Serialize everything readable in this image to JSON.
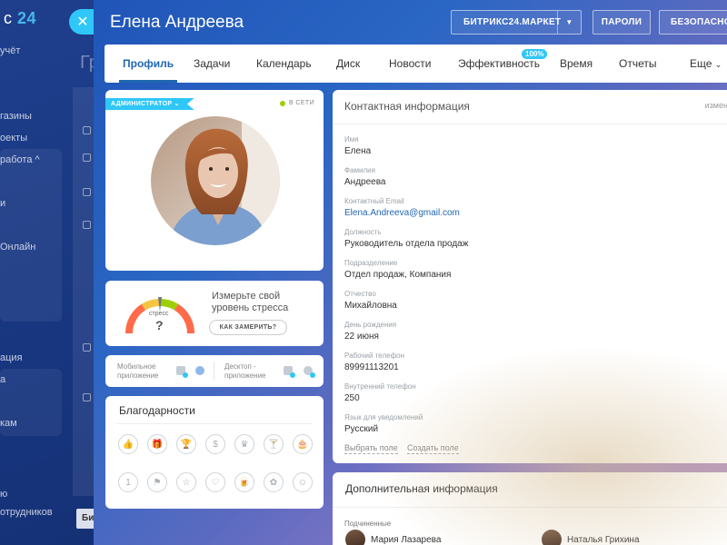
{
  "background": {
    "logo_prefix": "с",
    "logo_number": "24",
    "main_title": "Гр",
    "bottom_button": "Би",
    "sidebar_items": [
      "учёт",
      "газины",
      "оекты",
      "работа ^",
      "и",
      "Онлайн",
      "ация",
      "а",
      "кам",
      "ю",
      "отрудников"
    ]
  },
  "close_button": "✕",
  "profile": {
    "name": "Елена Андреева",
    "market_button": "БИТРИКС24.МАРКЕТ",
    "passwords_button": "ПАРОЛИ",
    "security_button": "БЕЗОПАСНОСТЬ"
  },
  "tabs": [
    {
      "label": "Профиль",
      "active": true
    },
    {
      "label": "Задачи"
    },
    {
      "label": "Календарь"
    },
    {
      "label": "Диск"
    },
    {
      "label": "Новости"
    },
    {
      "label": "Эффективность",
      "badge": "100%"
    },
    {
      "label": "Время"
    },
    {
      "label": "Отчеты"
    },
    {
      "label": "Еще"
    }
  ],
  "avatar_card": {
    "role": "АДМИНИСТРАТОР",
    "status": "В СЕТИ",
    "status_color": "#9dcf00"
  },
  "stress": {
    "gauge_label": "стресс",
    "gauge_value": "?",
    "text": "Измерьте свой уровень стресса",
    "text_line1": "Измерьте свой",
    "text_line2": "уровень стресса",
    "button": "КАК ЗАМЕРИТЬ?"
  },
  "apps": {
    "mobile_line1": "Мобильное",
    "mobile_line2": "приложение",
    "desktop_line1": "Десктоп -",
    "desktop_line2": "приложение"
  },
  "thanks": {
    "title": "Благодарности",
    "badges": [
      "thumbs-up",
      "gift",
      "cup",
      "money",
      "crown",
      "drink",
      "cake",
      "number-one",
      "flag",
      "star",
      "heart",
      "beer",
      "flower",
      "smile"
    ]
  },
  "contact": {
    "title": "Контактная информация",
    "edit": "измени",
    "fields": [
      {
        "label": "Имя",
        "value": "Елена"
      },
      {
        "label": "Фамилия",
        "value": "Андреева"
      },
      {
        "label": "Контактный Email",
        "value": "Elena.Andreeva@gmail.com"
      },
      {
        "label": "Должность",
        "value": "Руководитель отдела продаж"
      },
      {
        "label": "Подразделение",
        "value": "Отдел продаж, Компания"
      },
      {
        "label": "Отчество",
        "value": "Михайловна"
      },
      {
        "label": "День рождения",
        "value": "22 июня"
      },
      {
        "label": "Рабочий телефон",
        "value": "89991113201"
      },
      {
        "label": "Внутренний телефон",
        "value": "250"
      },
      {
        "label": "Язык для уведомлений",
        "value": "Русский"
      }
    ],
    "choose_field": "Выбрать поле",
    "create_field": "Создать поле"
  },
  "extra": {
    "title": "Дополнительная информация",
    "subordinates_label": "Подчиненные",
    "subordinates": [
      "Мария Лазарева",
      "Наталья Грихина"
    ]
  },
  "colors": {
    "accent": "#2fc7f7",
    "link": "#2067b0",
    "online": "#9dcf00"
  }
}
